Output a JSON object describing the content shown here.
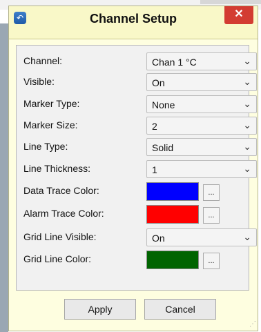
{
  "dialog": {
    "title": "Channel Setup",
    "close_label": "✕",
    "app_icon": "channel-setup-icon"
  },
  "fields": {
    "channel": {
      "label": "Channel:",
      "value": "Chan 1 °C"
    },
    "visible": {
      "label": "Visible:",
      "value": "On"
    },
    "marker_type": {
      "label": "Marker Type:",
      "value": "None"
    },
    "marker_size": {
      "label": "Marker Size:",
      "value": "2"
    },
    "line_type": {
      "label": "Line Type:",
      "value": "Solid"
    },
    "line_thickness": {
      "label": "Line Thickness:",
      "value": "1"
    },
    "data_trace_color": {
      "label": "Data Trace Color:",
      "color": "#0000ff",
      "picker_label": "..."
    },
    "alarm_trace_color": {
      "label": "Alarm Trace Color:",
      "color": "#ff0000",
      "picker_label": "..."
    },
    "grid_line_visible": {
      "label": "Grid Line Visible:",
      "value": "On"
    },
    "grid_line_color": {
      "label": "Grid Line Color:",
      "color": "#006400",
      "picker_label": "..."
    }
  },
  "buttons": {
    "apply": "Apply",
    "cancel": "Cancel"
  }
}
